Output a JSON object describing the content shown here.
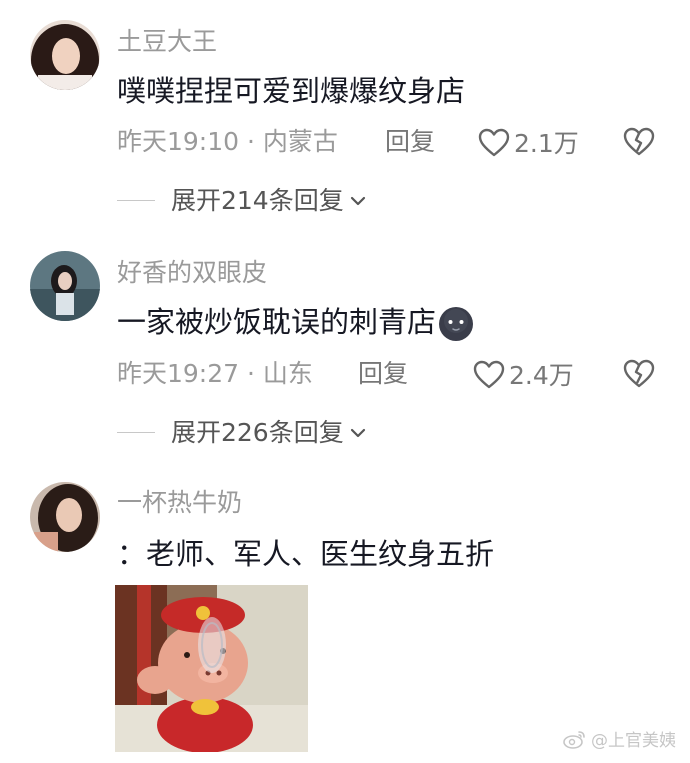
{
  "comments": [
    {
      "username": "土豆大王",
      "content": "噗噗捏捏可爱到爆爆纹身店",
      "meta": "昨天19:10 · 内蒙古",
      "reply_label": "回复",
      "likes": "2.1万",
      "expand_label": "展开214条回复"
    },
    {
      "username": "好香的双眼皮",
      "content": "一家被炒饭耽误的刺青店",
      "meta": "昨天19:27 · 山东",
      "reply_label": "回复",
      "likes": "2.4万",
      "expand_label": "展开226条回复"
    },
    {
      "username": "一杯热牛奶",
      "content": "：老师、军人、医生纹身五折"
    }
  ],
  "watermark": {
    "text": "@上官美姨"
  },
  "icons": {
    "like": "heart-outline-icon",
    "dislike": "broken-heart-icon",
    "expand": "chevron-down-icon",
    "emoji": "dark-face-emoji",
    "weibo": "weibo-logo-icon"
  },
  "colors": {
    "username": "#9a9a9a",
    "text": "#161823",
    "meta": "#9a9a9a"
  }
}
